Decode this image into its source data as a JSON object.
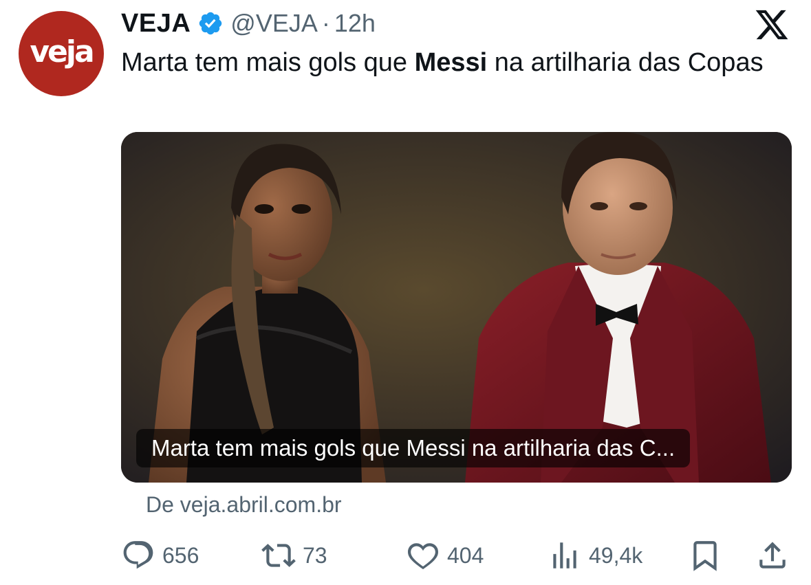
{
  "account": {
    "avatar_text": "veja",
    "display_name": "VEJA",
    "handle": "@VEJA",
    "separator": "·",
    "time": "12h"
  },
  "icons": {
    "verified": "verified-badge-icon",
    "platform": "x-logo-icon",
    "reply": "reply-icon",
    "retweet": "retweet-icon",
    "like": "like-icon",
    "views": "views-icon",
    "bookmark": "bookmark-icon",
    "share": "share-icon"
  },
  "tweet": {
    "text_before": "Marta tem mais gols que ",
    "text_bold": "Messi",
    "text_after": " na artilharia das Copas"
  },
  "card": {
    "caption": "Marta tem mais gols que Messi na artilharia das C...",
    "source": "De veja.abril.com.br"
  },
  "stats": {
    "replies": "656",
    "retweets": "73",
    "likes": "404",
    "views": "49,4k"
  },
  "colors": {
    "brand_red": "#b0281f",
    "verified_blue": "#1d9bf0",
    "secondary_text": "#536471",
    "primary_text": "#0f1419"
  }
}
